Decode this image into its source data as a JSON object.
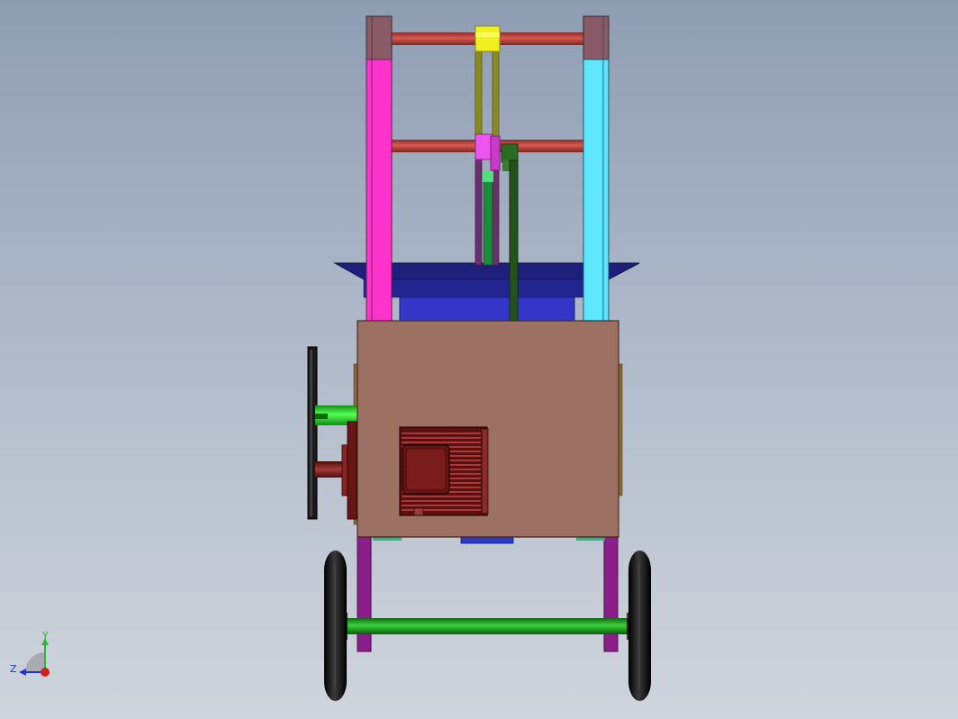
{
  "axis_triad": {
    "y_label": "Y",
    "z_label": "Z",
    "colors": {
      "y": "#2fb52f",
      "z": "#2233cc",
      "x": "#d02020"
    }
  },
  "parts": [
    "left-frame-post",
    "right-frame-post",
    "top-crossbar",
    "middle-crossbar",
    "upper-slider-block",
    "lower-slider-block",
    "guide-rod-left",
    "guide-rod-right",
    "pusher-rod",
    "vertical-drive-rod",
    "hopper-tray",
    "hopper-basin",
    "machine-housing",
    "motor",
    "side-handwheel",
    "drive-shaft",
    "pulley",
    "leg-left",
    "leg-right",
    "axle",
    "wheel-left",
    "wheel-right"
  ],
  "colors": {
    "left_post": "#ff33cc",
    "right_post": "#5ee6ff",
    "post_cap": "#8a5a66",
    "crossbar": "#c8504a",
    "slider_top": "#f0f020",
    "slider_mid": "#ee55ee",
    "guide_rod": "#8a8a20",
    "housing": "#9c7062",
    "hopper": "#1d1f7a",
    "hopper_basin": "#3436c8",
    "motor": "#7a1c1c",
    "shaft": "#33dd33",
    "axle": "#1ea51e",
    "leg": "#8c1e8c",
    "tire": "#0a0a0a",
    "handwheel": "#1a1a1a"
  }
}
